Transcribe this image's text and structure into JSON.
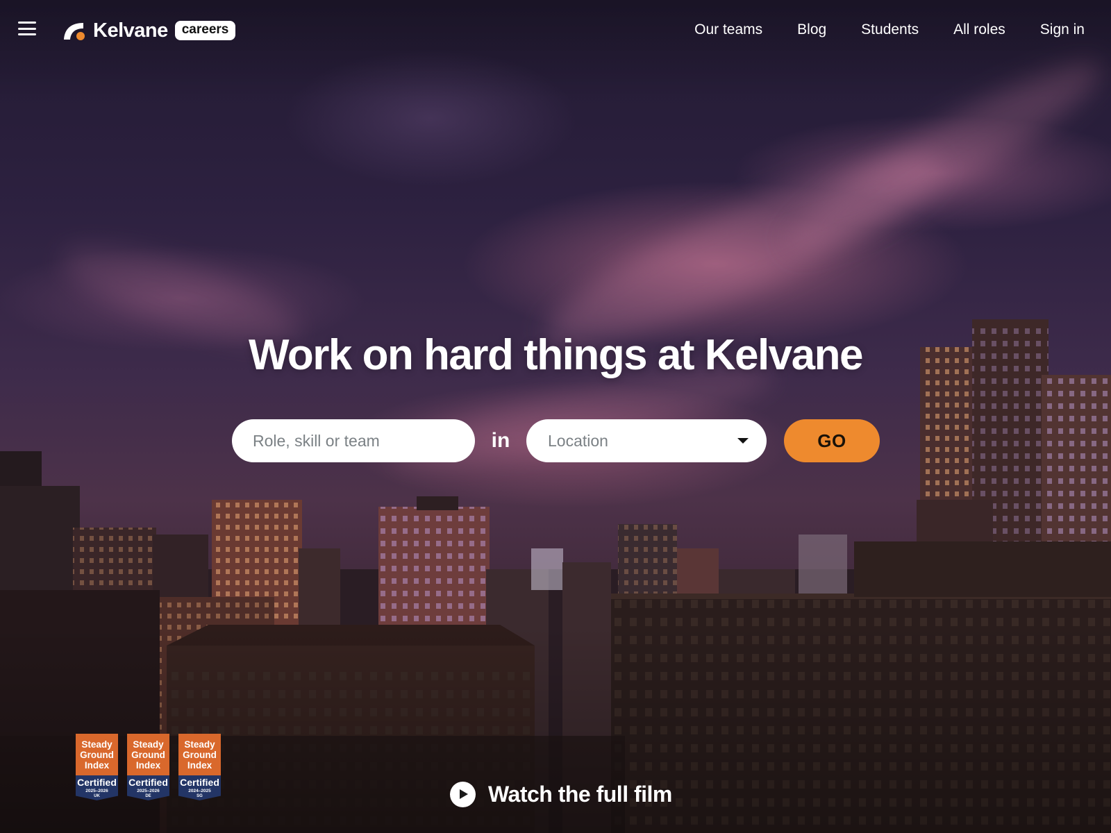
{
  "brand": {
    "name": "Kelvane",
    "tag": "careers",
    "accent_color": "#ee8a2e"
  },
  "nav": {
    "menu_icon": "hamburger-menu-icon",
    "items": [
      {
        "label": "Our teams"
      },
      {
        "label": "Blog"
      },
      {
        "label": "Students"
      },
      {
        "label": "All roles"
      },
      {
        "label": "Sign in"
      }
    ]
  },
  "hero": {
    "title": "Work on hard things at Kelvane",
    "search": {
      "role_placeholder": "Role, skill or team",
      "connector": "in",
      "location_placeholder": "Location",
      "go_label": "GO"
    },
    "film": {
      "label": "Watch the full film",
      "icon": "play-icon"
    }
  },
  "badges": [
    {
      "line1": "Steady",
      "line2": "Ground",
      "line3": "Index",
      "cert": "Certified",
      "years": "2025–2026",
      "region": "UK"
    },
    {
      "line1": "Steady",
      "line2": "Ground",
      "line3": "Index",
      "cert": "Certified",
      "years": "2025–2026",
      "region": "DE"
    },
    {
      "line1": "Steady",
      "line2": "Ground",
      "line3": "Index",
      "cert": "Certified",
      "years": "2024–2025",
      "region": "SG"
    }
  ]
}
